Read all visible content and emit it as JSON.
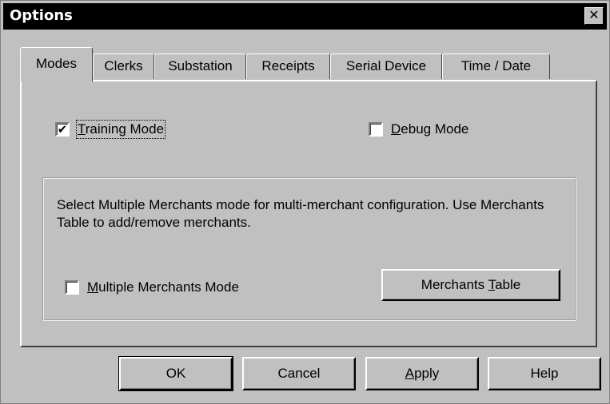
{
  "window": {
    "title": "Options",
    "close_glyph": "✕"
  },
  "tabs": [
    {
      "label": "Modes",
      "active": true
    },
    {
      "label": "Clerks"
    },
    {
      "label": "Substation"
    },
    {
      "label": "Receipts"
    },
    {
      "label": "Serial Device"
    },
    {
      "label": "Time / Date"
    }
  ],
  "modes": {
    "training_mode": {
      "label_prefix": "",
      "label_mnemonic": "T",
      "label_rest": "raining Mode",
      "checked": true,
      "check_glyph": "✔"
    },
    "debug_mode": {
      "label_prefix": "",
      "label_mnemonic": "D",
      "label_rest": "ebug Mode",
      "checked": false
    },
    "merchants_group": {
      "description": "Select Multiple Merchants mode for multi-merchant configuration. Use Merchants Table to add/remove merchants.",
      "multiple_merchants": {
        "label_prefix": "",
        "label_mnemonic": "M",
        "label_rest": "ultiple Merchants Mode",
        "checked": false
      },
      "merchants_table_button": {
        "label_prefix": "Merchants ",
        "label_mnemonic": "T",
        "label_rest": "able"
      }
    }
  },
  "buttons": {
    "ok": "OK",
    "cancel": "Cancel",
    "apply": {
      "label_prefix": "",
      "label_mnemonic": "A",
      "label_rest": "pply"
    },
    "help": "Help"
  }
}
